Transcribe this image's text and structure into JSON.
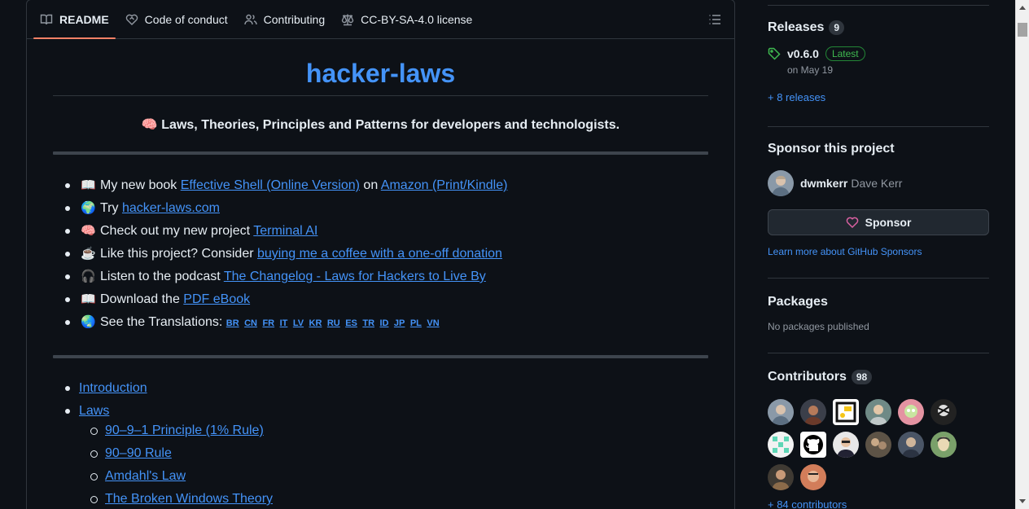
{
  "tabs": [
    {
      "label": "README",
      "icon": "book-icon"
    },
    {
      "label": "Code of conduct",
      "icon": "heart-handshake-icon"
    },
    {
      "label": "Contributing",
      "icon": "people-icon"
    },
    {
      "label": "CC-BY-SA-4.0 license",
      "icon": "law-icon"
    }
  ],
  "readme": {
    "title": "hacker-laws",
    "subtitle_emoji": "🧠",
    "subtitle": "Laws, Theories, Principles and Patterns for developers and technologists.",
    "bullets": [
      {
        "emoji": "📖",
        "pre": "My new book ",
        "link1": "Effective Shell (Online Version)",
        "mid": " on ",
        "link2": "Amazon (Print/Kindle)"
      },
      {
        "emoji": "🌍",
        "pre": "Try ",
        "link1": "hacker-laws.com"
      },
      {
        "emoji": "🧠",
        "pre": "Check out my new project ",
        "link1": "Terminal AI"
      },
      {
        "emoji": "☕",
        "pre": "Like this project? Consider ",
        "link1": "buying me a coffee with a one-off donation"
      },
      {
        "emoji": "🎧",
        "pre": "Listen to the podcast ",
        "link1": "The Changelog - Laws for Hackers to Live By"
      },
      {
        "emoji": "📖",
        "pre": "Download the ",
        "link1": "PDF eBook"
      },
      {
        "emoji": "🌏",
        "pre": "See the Translations: "
      }
    ],
    "translations": [
      "BR",
      "CN",
      "FR",
      "IT",
      "LV",
      "KR",
      "RU",
      "ES",
      "TR",
      "ID",
      "JP",
      "PL",
      "VN"
    ],
    "toc": {
      "introduction": "Introduction",
      "laws": "Laws",
      "laws_items": [
        "90–9–1 Principle (1% Rule)",
        "90–90 Rule",
        "Amdahl's Law",
        "The Broken Windows Theory"
      ]
    }
  },
  "sidebar": {
    "releases": {
      "title": "Releases",
      "count": "9",
      "version": "v0.6.0",
      "latest_badge": "Latest",
      "date": "on May 19",
      "more": "+ 8 releases"
    },
    "sponsor": {
      "title": "Sponsor this project",
      "username": "dwmkerr",
      "fullname": "Dave Kerr",
      "button": "Sponsor",
      "learn_more": "Learn more about GitHub Sponsors"
    },
    "packages": {
      "title": "Packages",
      "empty": "No packages published"
    },
    "contributors": {
      "title": "Contributors",
      "count": "98",
      "more": "+ 84 contributors"
    }
  },
  "colors": {
    "accent_link": "#4493f8",
    "tab_underline": "#f78166",
    "latest_green": "#3fb950",
    "sponsor_pink": "#db61a2"
  }
}
